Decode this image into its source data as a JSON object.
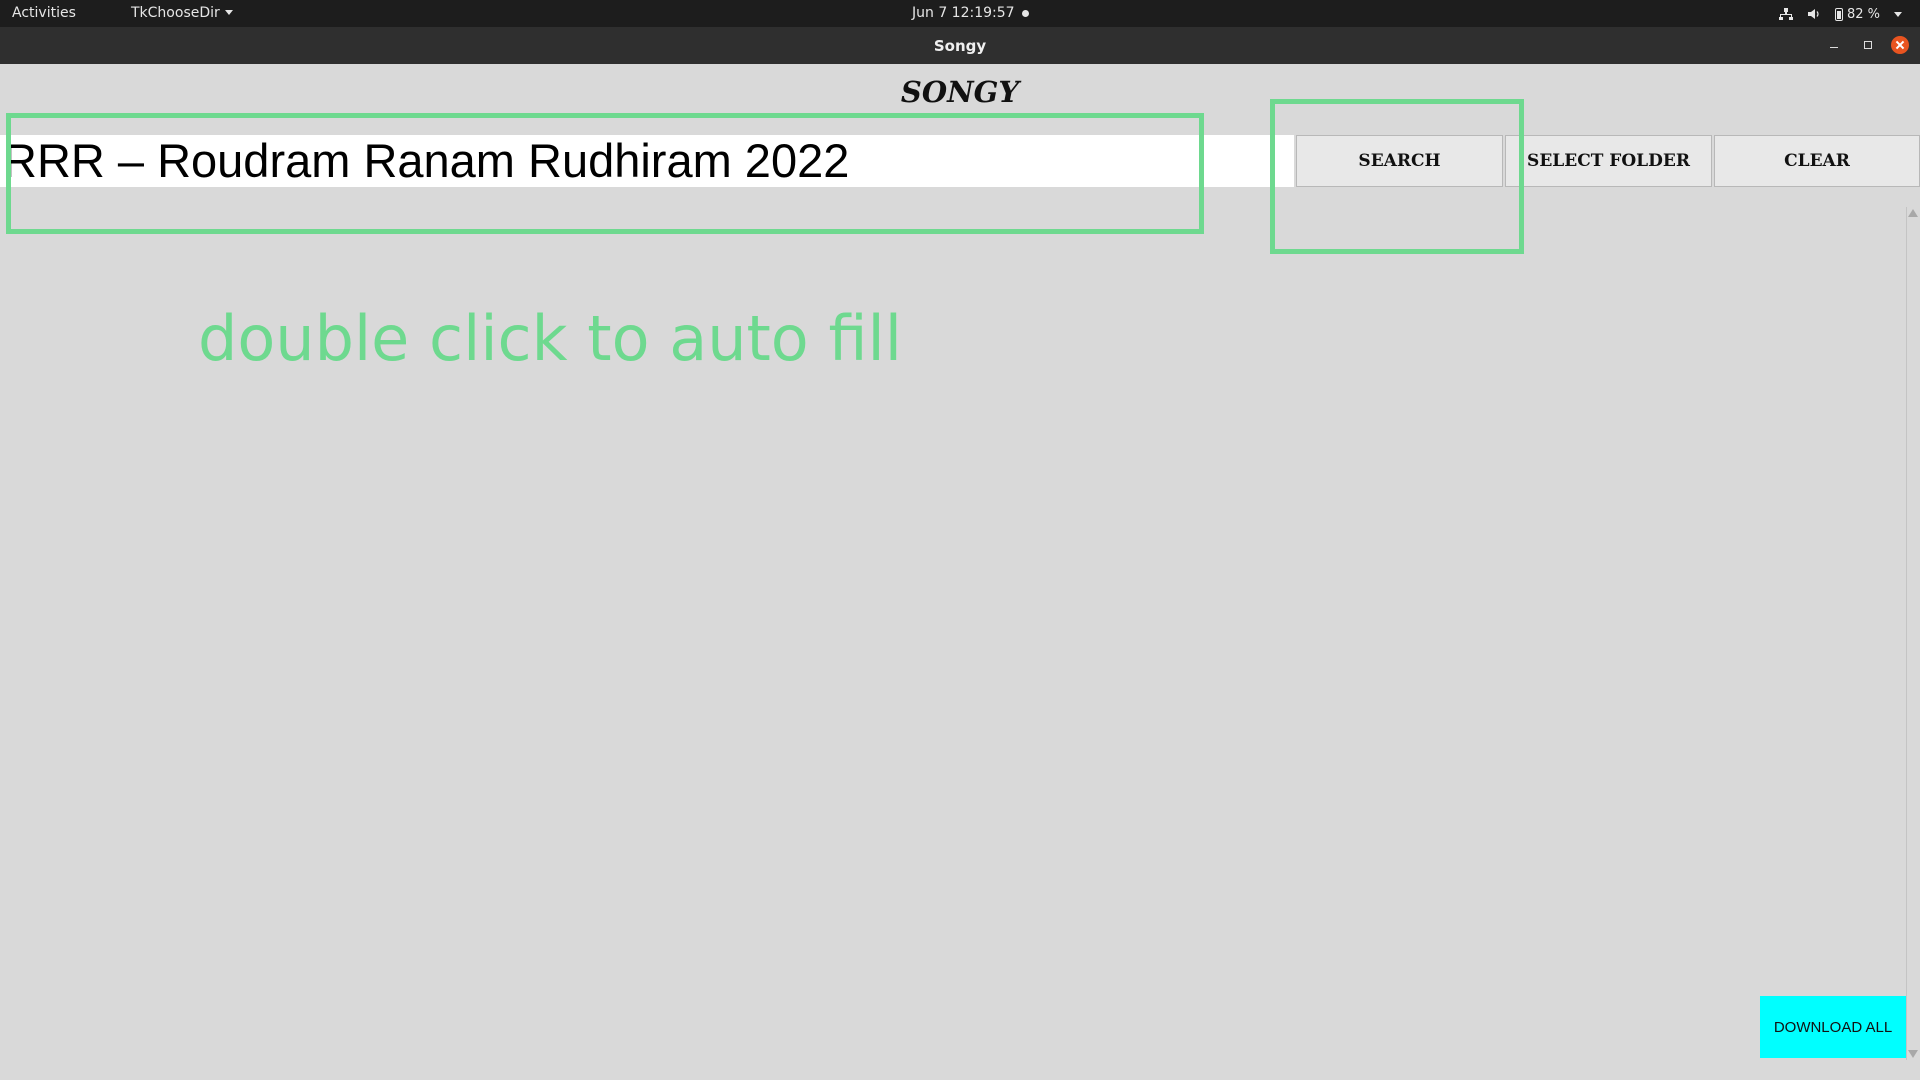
{
  "topbar": {
    "activities": "Activities",
    "app_menu": "TkChooseDir",
    "clock": "Jun 7  12:19:57",
    "battery": "82 %"
  },
  "window": {
    "title": "Songy"
  },
  "app": {
    "heading": "SONGY",
    "search_value": "RRR – Roudram Ranam Rudhiram 2022",
    "buttons": {
      "search": "SEARCH",
      "select_folder": "SELECT FOLDER",
      "clear": "CLEAR",
      "download_all": "DOWNLOAD ALL"
    }
  },
  "annotation": {
    "hint": "double click to auto fill"
  },
  "colors": {
    "annotation": "#6ed98f",
    "download_button": "#00ffff",
    "close_button": "#e95420"
  }
}
